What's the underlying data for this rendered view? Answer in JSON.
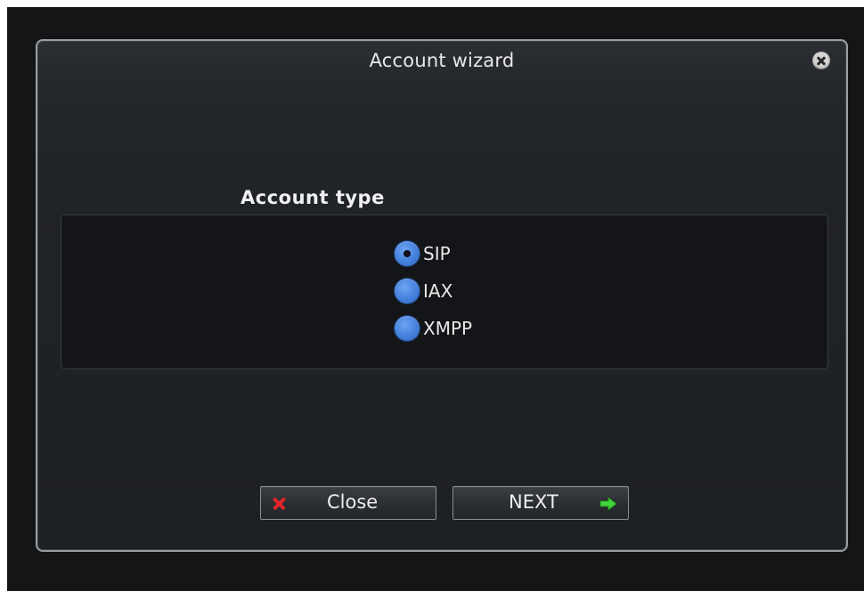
{
  "window": {
    "title": "Account wizard"
  },
  "account_type": {
    "heading": "Account type",
    "options": [
      {
        "label": "SIP",
        "selected": true
      },
      {
        "label": "IAX",
        "selected": false
      },
      {
        "label": "XMPP",
        "selected": false
      }
    ]
  },
  "buttons": {
    "close_label": "Close",
    "next_label": "NEXT"
  },
  "icons": {
    "window_close": "close-circle-icon",
    "close_button": "red-x-icon",
    "next_button": "green-arrow-right-icon"
  },
  "colors": {
    "radio_accent": "#4a86e0",
    "close_x": "#e2242b",
    "next_arrow": "#3fd43a"
  }
}
